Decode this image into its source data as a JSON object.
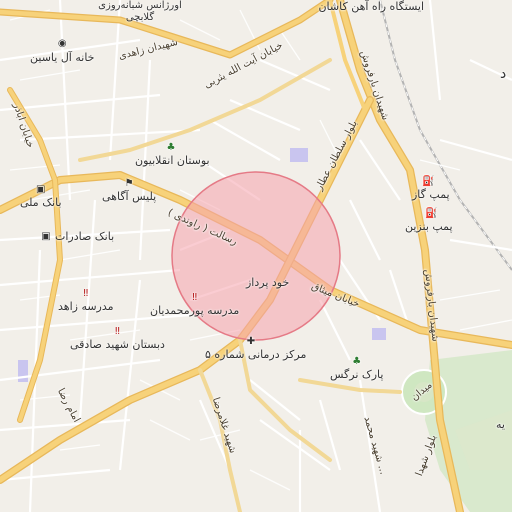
{
  "map": {
    "highlight": {
      "fill": "#f5a3ad",
      "stroke": "#e57a86"
    },
    "colors": {
      "background": "#f2efe9",
      "major_road": "#f7d27a",
      "major_road_edge": "#e8b85a",
      "minor_road": "#ffffff",
      "park": "#cfe7c1",
      "water_blue": "#c9c5ef"
    },
    "pois": [
      {
        "label": "ایستگاه راه آهن کاشان",
        "icon": "train-icon",
        "glyph": "🚆"
      },
      {
        "label": "اورژانس شبانه‌روزی گلابچی",
        "icon": "hospital-icon",
        "glyph": ""
      },
      {
        "label": "خانه آل یاسین",
        "icon": "museum-icon",
        "glyph": "◉"
      },
      {
        "label": "بوستان انقلابیون",
        "icon": "tree-icon",
        "glyph": "♣"
      },
      {
        "label": "پلیس آگاهی",
        "icon": "police-icon",
        "glyph": "⚑"
      },
      {
        "label": "بانک ملی",
        "icon": "bank-icon",
        "glyph": "▣"
      },
      {
        "label": "بانک صادرات",
        "icon": "bank-icon",
        "glyph": "▣"
      },
      {
        "label": "مدرسه زاهد",
        "icon": "school-icon",
        "glyph": "‼"
      },
      {
        "label": "مدرسه پورمحمدیان",
        "icon": "school-icon",
        "glyph": "‼"
      },
      {
        "label": "دبستان شهید صادقی",
        "icon": "school-icon",
        "glyph": "‼"
      },
      {
        "label": "مرکز درمانی شماره ۵",
        "icon": "medical-cross-icon",
        "glyph": "✚"
      },
      {
        "label": "پارک نرگس",
        "icon": "tree-icon",
        "glyph": "♣"
      },
      {
        "label": "پمپ گاز",
        "icon": "fuel-icon",
        "glyph": "⛽"
      },
      {
        "label": "پمپ بنزین",
        "icon": "fuel-icon",
        "glyph": "⛽"
      },
      {
        "label": "خود پرداز",
        "icon": "atm-icon",
        "glyph": ""
      }
    ],
    "roads": [
      "شهیدان زاهدی",
      "خیابان آیت الله یثربی",
      "شهیدان بارفروش",
      "بلوار سلطان عطار",
      "رسالت ( راوندی )",
      "خیابان میثاق",
      "خیابان اباذر",
      "امام رضا",
      "شهید غلامرضا",
      "شهید محمد ...",
      "بلوار شهدا",
      "میدان"
    ],
    "edge_letter": "د",
    "edge_letter_bottom": "یه"
  }
}
